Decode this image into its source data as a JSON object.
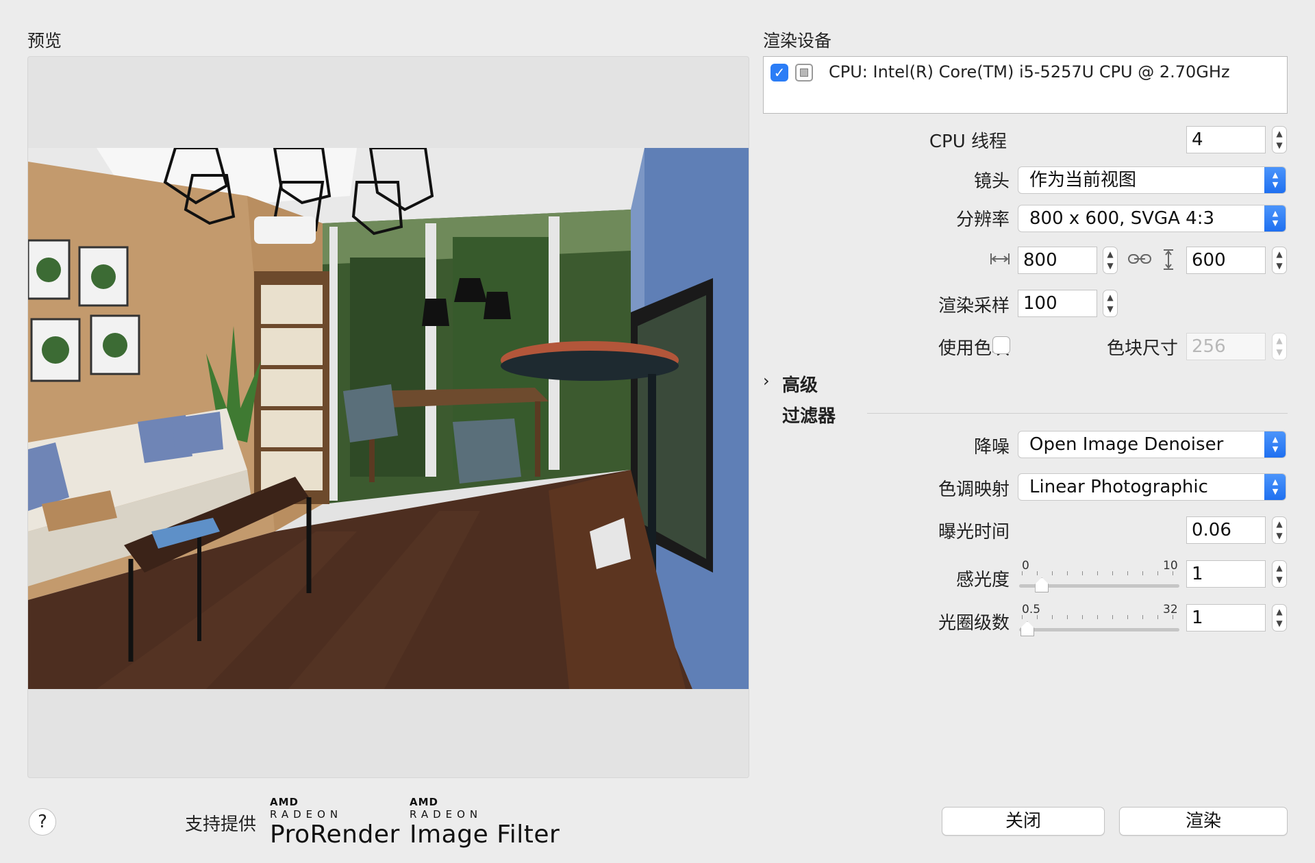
{
  "preview": {
    "title": "预览"
  },
  "render_device": {
    "title": "渲染设备",
    "devices": [
      {
        "label": "CPU: Intel(R) Core(TM) i5-5257U CPU @ 2.70GHz",
        "checked": true
      }
    ]
  },
  "settings": {
    "cpu_threads": {
      "label": "CPU 线程",
      "value": "4"
    },
    "camera": {
      "label": "镜头",
      "value": "作为当前视图"
    },
    "resolution": {
      "label": "分辨率",
      "value": "800 x 600, SVGA 4:3"
    },
    "width": {
      "value": "800"
    },
    "height": {
      "value": "600"
    },
    "samples": {
      "label": "渲染采样",
      "value": "100"
    },
    "use_tiles": {
      "label": "使用色块",
      "checked": false
    },
    "tile_size": {
      "label": "色块尺寸",
      "value": "256",
      "disabled": true
    }
  },
  "advanced": {
    "label": "高级",
    "expanded": false
  },
  "filters": {
    "title": "过滤器",
    "denoise": {
      "label": "降噪",
      "value": "Open Image Denoiser"
    },
    "tone_mapping": {
      "label": "色调映射",
      "value": "Linear Photographic"
    },
    "exposure": {
      "label": "曝光时间",
      "value": "0.06"
    },
    "iso": {
      "label": "感光度",
      "min": "0",
      "max": "10",
      "value": "1",
      "slider_fraction": 0.1
    },
    "fstop": {
      "label": "光圈级数",
      "min": "0.5",
      "max": "32",
      "value": "1",
      "slider_fraction": 0.0
    }
  },
  "footer": {
    "help": "?",
    "powered_by": "支持提供",
    "logos": [
      {
        "brand": "AMD",
        "line": "RADEON",
        "product": "ProRender"
      },
      {
        "brand": "AMD",
        "line": "RADEON",
        "product": "Image Filter"
      }
    ],
    "close_button": "关闭",
    "render_button": "渲染"
  },
  "colors": {
    "accent": "#2b7df6",
    "window_bg": "#ececec",
    "wall_beige": "#c49a6c",
    "wall_blue": "#5f7fb6",
    "floor_wood": "#4a2c1e"
  }
}
